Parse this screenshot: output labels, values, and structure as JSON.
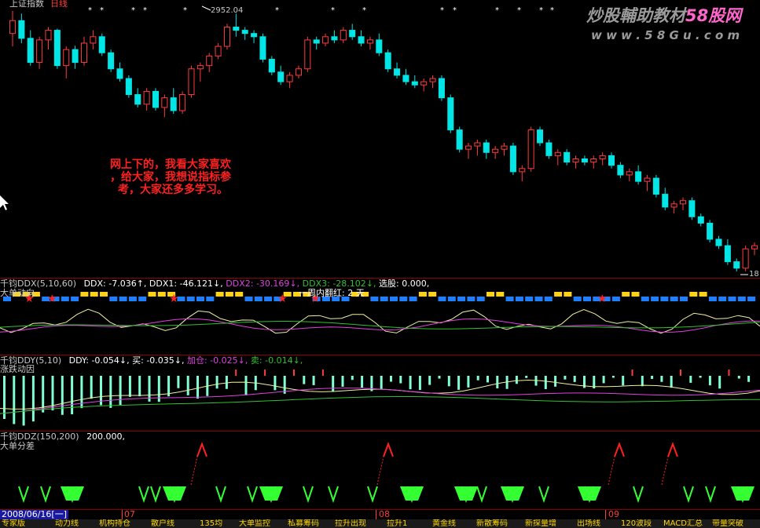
{
  "main": {
    "title": "上证指数",
    "period": "日线",
    "peak_label": "2952.04",
    "low_label": "18",
    "comment": [
      "网上下的，我看大家喜欢",
      "，给大家，我想说指标参",
      "考，大家还多多学习。"
    ],
    "watermark_cn_a": "炒股輔助教材",
    "watermark_num": "58",
    "watermark_cn_b": "股网",
    "watermark_url": "w w w . 5 8 G u . c o m",
    "colors": {
      "up": "#ff3b3b",
      "down": "#00e5e5",
      "annotation": "#ff2020",
      "watermark": "#9a9a9a",
      "watermark_accent": "#ff66cc"
    }
  },
  "ddx": {
    "name": "千钧DDX",
    "params": "(5,10,60)",
    "ddx": "DDX: -7.036↑,",
    "ddx1": "DDX1: -46.121↓,",
    "ddx2": "DDX2: -30.169↓,",
    "ddx3": "DDX3: -28.102↓,",
    "pick": "选股: 0.000,",
    "subtitle": "大单动向",
    "streak": "一周内翻红: 2 天"
  },
  "ddy": {
    "name": "千钧DDY",
    "params": "(5,10)",
    "ddy": "DDY: -0.054↓,",
    "buy": "买: -0.035↓,",
    "add": "加仓: -0.025↓,",
    "sell": "卖: -0.014↓,",
    "subtitle": "涨跌动因"
  },
  "ddz": {
    "name": "千钧DDZ",
    "params": "(150,200)",
    "value": "200.000,",
    "subtitle": "大单分差"
  },
  "timeline": {
    "date": "2008/06/16[一]",
    "m07": "07",
    "m08": "08",
    "m09": "09"
  },
  "tabs": [
    "专家版",
    "动力线",
    "机构持仓",
    "散户线",
    "135均",
    "大单监控",
    "私募筹码",
    "拉升出现",
    "拉升1",
    "黄金线",
    "新散筹码",
    "新探量增",
    "出场线",
    "120波段",
    "MACD汇总",
    "带量突破"
  ],
  "chart_data": {
    "type": "candlestick",
    "title": "上证指数",
    "candles": [
      {
        "o": 2890,
        "h": 2960,
        "l": 2850,
        "c": 2930
      },
      {
        "o": 2930,
        "h": 2952,
        "l": 2860,
        "c": 2875
      },
      {
        "o": 2875,
        "h": 2900,
        "l": 2790,
        "c": 2800
      },
      {
        "o": 2800,
        "h": 2880,
        "l": 2780,
        "c": 2870
      },
      {
        "o": 2870,
        "h": 2910,
        "l": 2840,
        "c": 2900
      },
      {
        "o": 2900,
        "h": 2905,
        "l": 2780,
        "c": 2790
      },
      {
        "o": 2790,
        "h": 2850,
        "l": 2750,
        "c": 2840
      },
      {
        "o": 2840,
        "h": 2852,
        "l": 2780,
        "c": 2800
      },
      {
        "o": 2800,
        "h": 2880,
        "l": 2790,
        "c": 2860
      },
      {
        "o": 2860,
        "h": 2900,
        "l": 2840,
        "c": 2880
      },
      {
        "o": 2880,
        "h": 2890,
        "l": 2820,
        "c": 2830
      },
      {
        "o": 2830,
        "h": 2840,
        "l": 2770,
        "c": 2780
      },
      {
        "o": 2780,
        "h": 2800,
        "l": 2740,
        "c": 2750
      },
      {
        "o": 2750,
        "h": 2760,
        "l": 2690,
        "c": 2700
      },
      {
        "o": 2700,
        "h": 2720,
        "l": 2660,
        "c": 2670
      },
      {
        "o": 2670,
        "h": 2720,
        "l": 2650,
        "c": 2710
      },
      {
        "o": 2710,
        "h": 2720,
        "l": 2650,
        "c": 2660
      },
      {
        "o": 2660,
        "h": 2700,
        "l": 2630,
        "c": 2690
      },
      {
        "o": 2690,
        "h": 2720,
        "l": 2640,
        "c": 2650
      },
      {
        "o": 2650,
        "h": 2710,
        "l": 2640,
        "c": 2700
      },
      {
        "o": 2700,
        "h": 2790,
        "l": 2690,
        "c": 2780
      },
      {
        "o": 2780,
        "h": 2800,
        "l": 2740,
        "c": 2790
      },
      {
        "o": 2790,
        "h": 2830,
        "l": 2770,
        "c": 2820
      },
      {
        "o": 2820,
        "h": 2860,
        "l": 2810,
        "c": 2850
      },
      {
        "o": 2850,
        "h": 2920,
        "l": 2840,
        "c": 2910
      },
      {
        "o": 2910,
        "h": 2952,
        "l": 2880,
        "c": 2900
      },
      {
        "o": 2900,
        "h": 2910,
        "l": 2870,
        "c": 2890
      },
      {
        "o": 2890,
        "h": 2900,
        "l": 2860,
        "c": 2880
      },
      {
        "o": 2880,
        "h": 2890,
        "l": 2800,
        "c": 2810
      },
      {
        "o": 2810,
        "h": 2820,
        "l": 2760,
        "c": 2770
      },
      {
        "o": 2770,
        "h": 2790,
        "l": 2730,
        "c": 2740
      },
      {
        "o": 2740,
        "h": 2770,
        "l": 2720,
        "c": 2760
      },
      {
        "o": 2760,
        "h": 2790,
        "l": 2750,
        "c": 2780
      },
      {
        "o": 2780,
        "h": 2880,
        "l": 2770,
        "c": 2870
      },
      {
        "o": 2870,
        "h": 2880,
        "l": 2840,
        "c": 2860
      },
      {
        "o": 2860,
        "h": 2890,
        "l": 2850,
        "c": 2880
      },
      {
        "o": 2880,
        "h": 2900,
        "l": 2860,
        "c": 2870
      },
      {
        "o": 2870,
        "h": 2910,
        "l": 2860,
        "c": 2900
      },
      {
        "o": 2900,
        "h": 2920,
        "l": 2870,
        "c": 2880
      },
      {
        "o": 2880,
        "h": 2900,
        "l": 2850,
        "c": 2860
      },
      {
        "o": 2860,
        "h": 2880,
        "l": 2840,
        "c": 2870
      },
      {
        "o": 2870,
        "h": 2890,
        "l": 2820,
        "c": 2830
      },
      {
        "o": 2830,
        "h": 2840,
        "l": 2770,
        "c": 2780
      },
      {
        "o": 2780,
        "h": 2800,
        "l": 2750,
        "c": 2760
      },
      {
        "o": 2760,
        "h": 2780,
        "l": 2730,
        "c": 2740
      },
      {
        "o": 2740,
        "h": 2760,
        "l": 2720,
        "c": 2730
      },
      {
        "o": 2730,
        "h": 2750,
        "l": 2710,
        "c": 2740
      },
      {
        "o": 2740,
        "h": 2760,
        "l": 2720,
        "c": 2750
      },
      {
        "o": 2750,
        "h": 2760,
        "l": 2680,
        "c": 2690
      },
      {
        "o": 2690,
        "h": 2700,
        "l": 2580,
        "c": 2590
      },
      {
        "o": 2590,
        "h": 2600,
        "l": 2520,
        "c": 2530
      },
      {
        "o": 2530,
        "h": 2550,
        "l": 2500,
        "c": 2540
      },
      {
        "o": 2540,
        "h": 2560,
        "l": 2510,
        "c": 2550
      },
      {
        "o": 2550,
        "h": 2560,
        "l": 2500,
        "c": 2520
      },
      {
        "o": 2520,
        "h": 2540,
        "l": 2500,
        "c": 2530
      },
      {
        "o": 2530,
        "h": 2550,
        "l": 2510,
        "c": 2540
      },
      {
        "o": 2540,
        "h": 2550,
        "l": 2450,
        "c": 2460
      },
      {
        "o": 2460,
        "h": 2480,
        "l": 2430,
        "c": 2470
      },
      {
        "o": 2470,
        "h": 2600,
        "l": 2460,
        "c": 2590
      },
      {
        "o": 2590,
        "h": 2600,
        "l": 2540,
        "c": 2550
      },
      {
        "o": 2550,
        "h": 2560,
        "l": 2500,
        "c": 2510
      },
      {
        "o": 2510,
        "h": 2530,
        "l": 2480,
        "c": 2520
      },
      {
        "o": 2520,
        "h": 2530,
        "l": 2480,
        "c": 2490
      },
      {
        "o": 2490,
        "h": 2510,
        "l": 2470,
        "c": 2500
      },
      {
        "o": 2500,
        "h": 2510,
        "l": 2480,
        "c": 2490
      },
      {
        "o": 2490,
        "h": 2510,
        "l": 2470,
        "c": 2500
      },
      {
        "o": 2500,
        "h": 2520,
        "l": 2480,
        "c": 2510
      },
      {
        "o": 2510,
        "h": 2520,
        "l": 2470,
        "c": 2480
      },
      {
        "o": 2480,
        "h": 2490,
        "l": 2440,
        "c": 2450
      },
      {
        "o": 2450,
        "h": 2470,
        "l": 2430,
        "c": 2460
      },
      {
        "o": 2460,
        "h": 2480,
        "l": 2420,
        "c": 2430
      },
      {
        "o": 2430,
        "h": 2450,
        "l": 2400,
        "c": 2440
      },
      {
        "o": 2440,
        "h": 2450,
        "l": 2380,
        "c": 2390
      },
      {
        "o": 2390,
        "h": 2410,
        "l": 2340,
        "c": 2350
      },
      {
        "o": 2350,
        "h": 2370,
        "l": 2330,
        "c": 2360
      },
      {
        "o": 2360,
        "h": 2380,
        "l": 2340,
        "c": 2370
      },
      {
        "o": 2370,
        "h": 2380,
        "l": 2310,
        "c": 2320
      },
      {
        "o": 2320,
        "h": 2330,
        "l": 2290,
        "c": 2300
      },
      {
        "o": 2300,
        "h": 2310,
        "l": 2240,
        "c": 2250
      },
      {
        "o": 2250,
        "h": 2260,
        "l": 2220,
        "c": 2230
      },
      {
        "o": 2230,
        "h": 2250,
        "l": 2170,
        "c": 2180
      },
      {
        "o": 2180,
        "h": 2190,
        "l": 2150,
        "c": 2160
      },
      {
        "o": 2160,
        "h": 2230,
        "l": 2150,
        "c": 2220
      },
      {
        "o": 2220,
        "h": 2240,
        "l": 2200,
        "c": 2230
      }
    ]
  }
}
